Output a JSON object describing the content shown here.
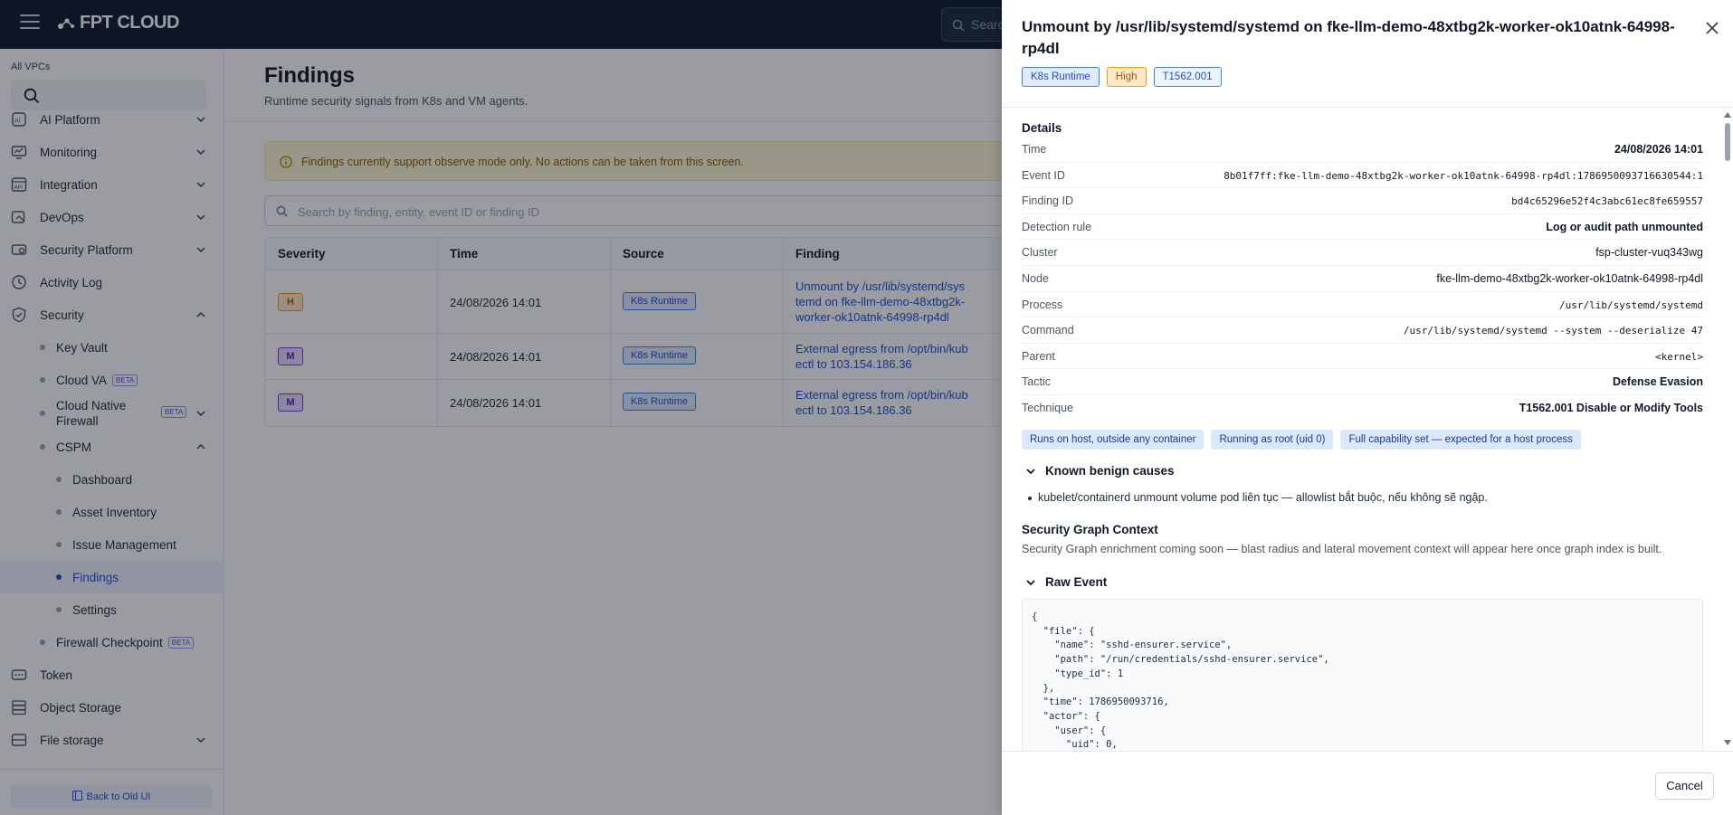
{
  "topbar": {
    "brand": "FPT CLOUD",
    "search_placeholder": "Search"
  },
  "sidebar": {
    "vpc_label": "All VPCs",
    "items": [
      {
        "label": "AI Platform"
      },
      {
        "label": "Monitoring"
      },
      {
        "label": "Integration"
      },
      {
        "label": "DevOps"
      },
      {
        "label": "Security Platform"
      },
      {
        "label": "Activity Log"
      },
      {
        "label": "Security"
      }
    ],
    "security_sub": [
      {
        "label": "Key Vault"
      },
      {
        "label": "Cloud VA",
        "badge": "BETA"
      },
      {
        "label": "Cloud Native Firewall",
        "badge": "BETA"
      },
      {
        "label": "CSPM"
      }
    ],
    "cspm_sub": [
      {
        "label": "Dashboard"
      },
      {
        "label": "Asset Inventory"
      },
      {
        "label": "Issue Management"
      },
      {
        "label": "Findings"
      },
      {
        "label": "Settings"
      }
    ],
    "firewall_checkpoint": {
      "label": "Firewall Checkpoint",
      "badge": "BETA"
    },
    "bottom_items": [
      {
        "label": "Token"
      },
      {
        "label": "Object Storage"
      },
      {
        "label": "File storage"
      }
    ],
    "back_button": "Back to Old UI"
  },
  "main": {
    "title": "Findings",
    "subtitle": "Runtime security signals from K8s and VM agents.",
    "banner": "Findings currently support observe mode only. No actions can be taken from this screen.",
    "search_placeholder": "Search by finding, entity, event ID or finding ID",
    "columns": [
      "Severity",
      "Time",
      "Source",
      "Finding"
    ],
    "rows": [
      {
        "severity": "H",
        "time": "24/08/2026 14:01",
        "source": "K8s Runtime",
        "finding_lines": [
          "Unmount by /usr/lib/systemd/sys",
          "temd on fke-llm-demo-48xtbg2k-",
          "worker-ok10atnk-64998-rp4dl"
        ]
      },
      {
        "severity": "M",
        "time": "24/08/2026 14:01",
        "source": "K8s Runtime",
        "finding_lines": [
          "External egress from /opt/bin/kub",
          "ectl to 103.154.186.36"
        ]
      },
      {
        "severity": "M",
        "time": "24/08/2026 14:01",
        "source": "K8s Runtime",
        "finding_lines": [
          "External egress from /opt/bin/kub",
          "ectl to 103.154.186.36"
        ]
      }
    ]
  },
  "drawer": {
    "title": "Unmount by /usr/lib/systemd/systemd on fke-llm-demo-48xtbg2k-worker-ok10atnk-64998-rp4dl",
    "tags": [
      "K8s Runtime",
      "High",
      "T1562.001"
    ],
    "details_title": "Details",
    "details": [
      {
        "key": "Time",
        "value": "24/08/2026 14:01"
      },
      {
        "key": "Event ID",
        "value": "8b01f7ff:fke-llm-demo-48xtbg2k-worker-ok10atnk-64998-rp4dl:1786950093716630544:1"
      },
      {
        "key": "Finding ID",
        "value": "bd4c65296e52f4c3abc61ec8fe659557"
      },
      {
        "key": "Detection rule",
        "value": "Log or audit path unmounted"
      },
      {
        "key": "Cluster",
        "value": "fsp-cluster-vuq343wg"
      },
      {
        "key": "Node",
        "value": "fke-llm-demo-48xtbg2k-worker-ok10atnk-64998-rp4dl"
      },
      {
        "key": "Process",
        "value": "/usr/lib/systemd/systemd"
      },
      {
        "key": "Command",
        "value": "/usr/lib/systemd/systemd --system --deserialize 47"
      },
      {
        "key": "Parent",
        "value": "<kernel>"
      },
      {
        "key": "Tactic",
        "value": "Defense Evasion"
      },
      {
        "key": "Technique",
        "value": "T1562.001 Disable or Modify Tools"
      }
    ],
    "chips": [
      "Runs on host, outside any container",
      "Running as root (uid 0)",
      "Full capability set — expected for a host process"
    ],
    "benign_title": "Known benign causes",
    "benign_item": "kubelet/containerd unmount volume pod liên tục — allowlist bắt buộc, nếu không sẽ ngập.",
    "graph_title": "Security Graph Context",
    "graph_text": "Security Graph enrichment coming soon — blast radius and lateral movement context will appear here once graph index is built.",
    "raw_title": "Raw Event",
    "raw_event": "{\n  \"file\": {\n    \"name\": \"sshd-ensurer.service\",\n    \"path\": \"/run/credentials/sshd-ensurer.service\",\n    \"type_id\": 1\n  },\n  \"time\": 1786950093716,\n  \"actor\": {\n    \"user\": {\n      \"uid\": 0,",
    "cancel": "Cancel"
  }
}
